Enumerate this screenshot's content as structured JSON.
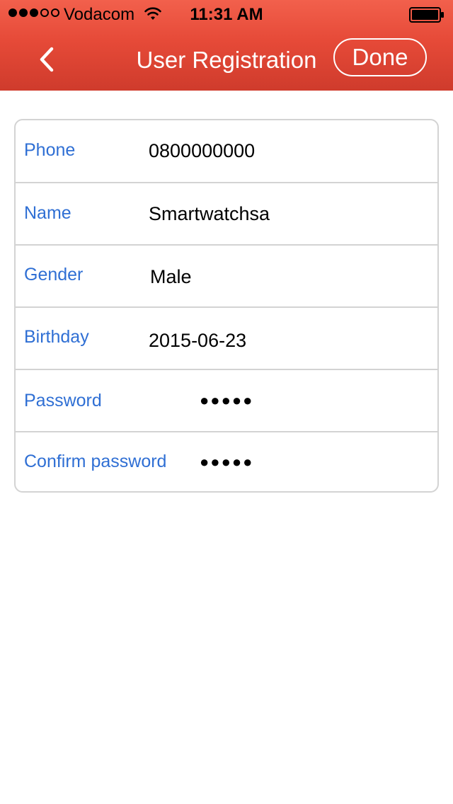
{
  "status_bar": {
    "signal_bars": [
      true,
      true,
      true,
      false,
      false
    ],
    "carrier": "Vodacom",
    "time": "11:31 AM",
    "wifi_icon": "wifi-icon",
    "battery_icon": "battery-full-icon"
  },
  "nav": {
    "back_icon": "chevron-left-icon",
    "title": "User Registration",
    "done_label": "Done"
  },
  "form": {
    "fields": [
      {
        "label": "Phone",
        "value": "0800000000"
      },
      {
        "label": "Name",
        "value": "Smartwatchsa"
      },
      {
        "label": "Gender",
        "value": "Male"
      },
      {
        "label": "Birthday",
        "value": "2015-06-23"
      },
      {
        "label": "Password",
        "value": "●●●●●"
      },
      {
        "label": "Confirm password",
        "value": "●●●●●"
      }
    ]
  },
  "colors": {
    "header": "#e64a38",
    "label": "#2f6fd4",
    "border": "#d3d3d3"
  }
}
